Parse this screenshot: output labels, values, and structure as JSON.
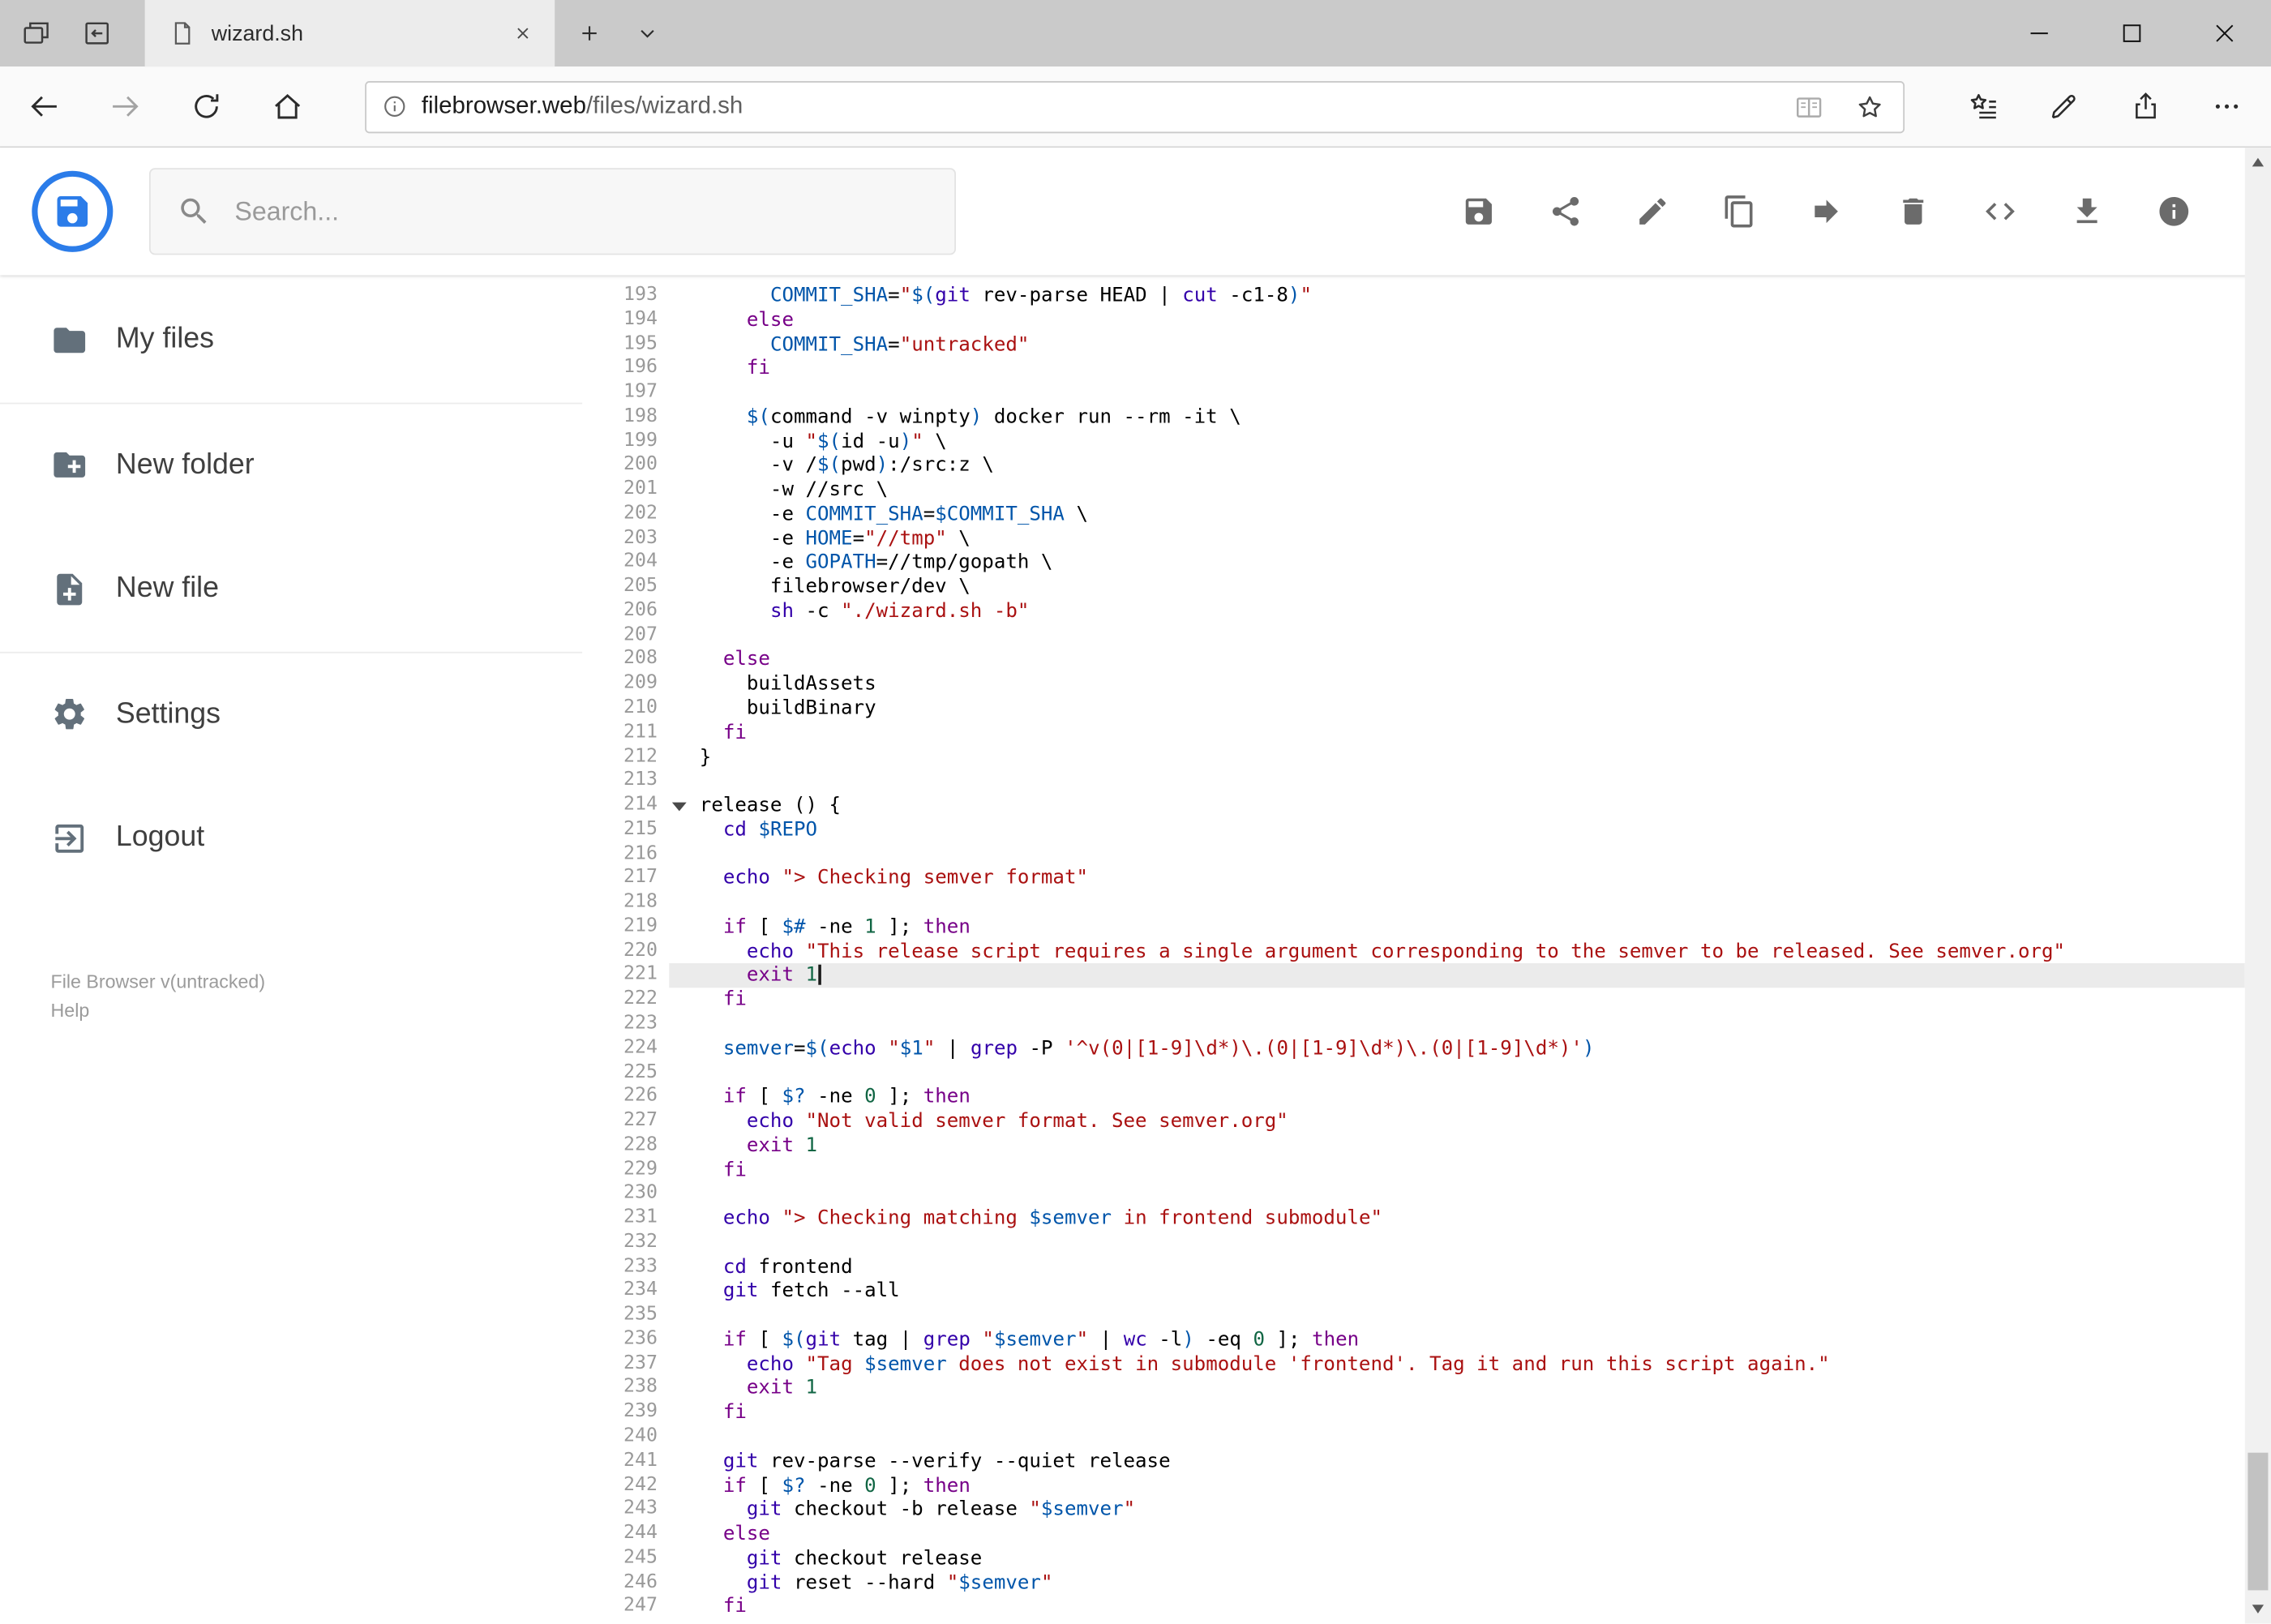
{
  "window": {
    "tab_title": "wizard.sh",
    "tabbar_icons": [
      "tab-preview-icon",
      "set-tabs-aside-icon",
      "page-icon",
      "close-tab-icon",
      "new-tab-icon",
      "tab-list-chevron-icon"
    ],
    "control_icons": [
      "minimize-icon",
      "maximize-icon",
      "close-icon"
    ]
  },
  "browser": {
    "url_domain": "filebrowser.web",
    "url_path": "/files/wizard.sh",
    "nav_icons": [
      "back-icon",
      "forward-icon",
      "refresh-icon",
      "home-icon",
      "site-info-icon",
      "reading-view-icon",
      "favorite-star-icon",
      "hub-icon",
      "web-note-pen-icon",
      "share-icon",
      "more-options-icon"
    ]
  },
  "app_header": {
    "search_placeholder": "Search...",
    "logo_icon": "file-browser-floppy-logo",
    "action_icons": [
      "save-icon",
      "share-icon",
      "edit-icon",
      "copy-icon",
      "move-icon",
      "delete-icon",
      "switch-view-icon",
      "download-icon",
      "info-icon"
    ]
  },
  "sidebar": {
    "items": [
      {
        "label": "My files",
        "icon": "folder-icon"
      },
      {
        "label": "New folder",
        "icon": "new-folder-icon"
      },
      {
        "label": "New file",
        "icon": "new-file-icon"
      },
      {
        "label": "Settings",
        "icon": "settings-gear-icon"
      },
      {
        "label": "Logout",
        "icon": "logout-icon"
      }
    ],
    "credits": "File Browser v(untracked)",
    "help": "Help"
  },
  "colors": {
    "accent_blue": "#2b7ce9",
    "active_line_bg": "#ebebeb",
    "gutter_number": "#999999"
  },
  "scrollbar": {
    "thumb_top_pct": 90,
    "thumb_height_pct": 9.7
  },
  "editor": {
    "language": "shell",
    "active_line": 221,
    "folded_marker_line": 214,
    "token_colors": {
      "pl": "#000000",
      "kw": "#770088",
      "bi": "#3300aa",
      "st": "#aa1111",
      "va": "#0055aa",
      "nu": "#116644"
    },
    "lines": [
      {
        "n": 193,
        "t": [
          [
            "pl",
            "      "
          ],
          [
            "va",
            "COMMIT_SHA"
          ],
          [
            "pl",
            "="
          ],
          [
            "st",
            "\""
          ],
          [
            "va",
            "$("
          ],
          [
            "bi",
            "git"
          ],
          [
            "pl",
            " rev-parse HEAD | "
          ],
          [
            "bi",
            "cut"
          ],
          [
            "pl",
            " -c1-8"
          ],
          [
            "va",
            ")"
          ],
          [
            "st",
            "\""
          ]
        ]
      },
      {
        "n": 194,
        "t": [
          [
            "pl",
            "    "
          ],
          [
            "kw",
            "else"
          ]
        ]
      },
      {
        "n": 195,
        "t": [
          [
            "pl",
            "      "
          ],
          [
            "va",
            "COMMIT_SHA"
          ],
          [
            "pl",
            "="
          ],
          [
            "st",
            "\"untracked\""
          ]
        ]
      },
      {
        "n": 196,
        "t": [
          [
            "pl",
            "    "
          ],
          [
            "kw",
            "fi"
          ]
        ]
      },
      {
        "n": 197,
        "t": []
      },
      {
        "n": 198,
        "t": [
          [
            "pl",
            "    "
          ],
          [
            "va",
            "$("
          ],
          [
            "pl",
            "command -v winpty"
          ],
          [
            "va",
            ")"
          ],
          [
            "pl",
            " docker run --rm -it \\"
          ]
        ]
      },
      {
        "n": 199,
        "t": [
          [
            "pl",
            "      -u "
          ],
          [
            "st",
            "\""
          ],
          [
            "va",
            "$("
          ],
          [
            "pl",
            "id -u"
          ],
          [
            "va",
            ")"
          ],
          [
            "st",
            "\""
          ],
          [
            "pl",
            " \\"
          ]
        ]
      },
      {
        "n": 200,
        "t": [
          [
            "pl",
            "      -v /"
          ],
          [
            "va",
            "$("
          ],
          [
            "pl",
            "pwd"
          ],
          [
            "va",
            ")"
          ],
          [
            "pl",
            ":/src:z \\"
          ]
        ]
      },
      {
        "n": 201,
        "t": [
          [
            "pl",
            "      -w //src \\"
          ]
        ]
      },
      {
        "n": 202,
        "t": [
          [
            "pl",
            "      -e "
          ],
          [
            "va",
            "COMMIT_SHA"
          ],
          [
            "pl",
            "="
          ],
          [
            "va",
            "$COMMIT_SHA"
          ],
          [
            "pl",
            " \\"
          ]
        ]
      },
      {
        "n": 203,
        "t": [
          [
            "pl",
            "      -e "
          ],
          [
            "va",
            "HOME"
          ],
          [
            "pl",
            "="
          ],
          [
            "st",
            "\"//tmp\""
          ],
          [
            "pl",
            " \\"
          ]
        ]
      },
      {
        "n": 204,
        "t": [
          [
            "pl",
            "      -e "
          ],
          [
            "va",
            "GOPATH"
          ],
          [
            "pl",
            "=//tmp/gopath \\"
          ]
        ]
      },
      {
        "n": 205,
        "t": [
          [
            "pl",
            "      filebrowser/dev \\"
          ]
        ]
      },
      {
        "n": 206,
        "t": [
          [
            "pl",
            "      "
          ],
          [
            "bi",
            "sh"
          ],
          [
            "pl",
            " -c "
          ],
          [
            "st",
            "\"./wizard.sh -b\""
          ]
        ]
      },
      {
        "n": 207,
        "t": []
      },
      {
        "n": 208,
        "t": [
          [
            "pl",
            "  "
          ],
          [
            "kw",
            "else"
          ]
        ]
      },
      {
        "n": 209,
        "t": [
          [
            "pl",
            "    buildAssets"
          ]
        ]
      },
      {
        "n": 210,
        "t": [
          [
            "pl",
            "    buildBinary"
          ]
        ]
      },
      {
        "n": 211,
        "t": [
          [
            "pl",
            "  "
          ],
          [
            "kw",
            "fi"
          ]
        ]
      },
      {
        "n": 212,
        "t": [
          [
            "pl",
            "}"
          ]
        ]
      },
      {
        "n": 213,
        "t": []
      },
      {
        "n": 214,
        "t": [
          [
            "pl",
            "release () {"
          ]
        ]
      },
      {
        "n": 215,
        "t": [
          [
            "pl",
            "  "
          ],
          [
            "bi",
            "cd"
          ],
          [
            "pl",
            " "
          ],
          [
            "va",
            "$REPO"
          ]
        ]
      },
      {
        "n": 216,
        "t": []
      },
      {
        "n": 217,
        "t": [
          [
            "pl",
            "  "
          ],
          [
            "bi",
            "echo"
          ],
          [
            "pl",
            " "
          ],
          [
            "st",
            "\"> Checking semver format\""
          ]
        ]
      },
      {
        "n": 218,
        "t": []
      },
      {
        "n": 219,
        "t": [
          [
            "pl",
            "  "
          ],
          [
            "kw",
            "if"
          ],
          [
            "pl",
            " [ "
          ],
          [
            "va",
            "$#"
          ],
          [
            "pl",
            " -ne "
          ],
          [
            "nu",
            "1"
          ],
          [
            "pl",
            " ]; "
          ],
          [
            "kw",
            "then"
          ]
        ]
      },
      {
        "n": 220,
        "t": [
          [
            "pl",
            "    "
          ],
          [
            "bi",
            "echo"
          ],
          [
            "pl",
            " "
          ],
          [
            "st",
            "\"This release script requires a single argument corresponding to the semver to be released. See semver.org\""
          ]
        ]
      },
      {
        "n": 221,
        "t": [
          [
            "pl",
            "    "
          ],
          [
            "kw",
            "exit"
          ],
          [
            "pl",
            " "
          ],
          [
            "nu",
            "1"
          ]
        ]
      },
      {
        "n": 222,
        "t": [
          [
            "pl",
            "  "
          ],
          [
            "kw",
            "fi"
          ]
        ]
      },
      {
        "n": 223,
        "t": []
      },
      {
        "n": 224,
        "t": [
          [
            "pl",
            "  "
          ],
          [
            "va",
            "semver"
          ],
          [
            "pl",
            "="
          ],
          [
            "va",
            "$("
          ],
          [
            "bi",
            "echo"
          ],
          [
            "pl",
            " "
          ],
          [
            "st",
            "\""
          ],
          [
            "va",
            "$1"
          ],
          [
            "st",
            "\""
          ],
          [
            "pl",
            " | "
          ],
          [
            "bi",
            "grep"
          ],
          [
            "pl",
            " -P "
          ],
          [
            "st",
            "'^v(0|[1-9]\\d*)\\.(0|[1-9]\\d*)\\.(0|[1-9]\\d*)'"
          ],
          [
            "va",
            ")"
          ]
        ]
      },
      {
        "n": 225,
        "t": []
      },
      {
        "n": 226,
        "t": [
          [
            "pl",
            "  "
          ],
          [
            "kw",
            "if"
          ],
          [
            "pl",
            " [ "
          ],
          [
            "va",
            "$?"
          ],
          [
            "pl",
            " -ne "
          ],
          [
            "nu",
            "0"
          ],
          [
            "pl",
            " ]; "
          ],
          [
            "kw",
            "then"
          ]
        ]
      },
      {
        "n": 227,
        "t": [
          [
            "pl",
            "    "
          ],
          [
            "bi",
            "echo"
          ],
          [
            "pl",
            " "
          ],
          [
            "st",
            "\"Not valid semver format. See semver.org\""
          ]
        ]
      },
      {
        "n": 228,
        "t": [
          [
            "pl",
            "    "
          ],
          [
            "kw",
            "exit"
          ],
          [
            "pl",
            " "
          ],
          [
            "nu",
            "1"
          ]
        ]
      },
      {
        "n": 229,
        "t": [
          [
            "pl",
            "  "
          ],
          [
            "kw",
            "fi"
          ]
        ]
      },
      {
        "n": 230,
        "t": []
      },
      {
        "n": 231,
        "t": [
          [
            "pl",
            "  "
          ],
          [
            "bi",
            "echo"
          ],
          [
            "pl",
            " "
          ],
          [
            "st",
            "\"> Checking matching "
          ],
          [
            "va",
            "$semver"
          ],
          [
            "st",
            " in frontend submodule\""
          ]
        ]
      },
      {
        "n": 232,
        "t": []
      },
      {
        "n": 233,
        "t": [
          [
            "pl",
            "  "
          ],
          [
            "bi",
            "cd"
          ],
          [
            "pl",
            " frontend"
          ]
        ]
      },
      {
        "n": 234,
        "t": [
          [
            "pl",
            "  "
          ],
          [
            "bi",
            "git"
          ],
          [
            "pl",
            " fetch --all"
          ]
        ]
      },
      {
        "n": 235,
        "t": []
      },
      {
        "n": 236,
        "t": [
          [
            "pl",
            "  "
          ],
          [
            "kw",
            "if"
          ],
          [
            "pl",
            " [ "
          ],
          [
            "va",
            "$("
          ],
          [
            "bi",
            "git"
          ],
          [
            "pl",
            " tag | "
          ],
          [
            "bi",
            "grep"
          ],
          [
            "pl",
            " "
          ],
          [
            "st",
            "\""
          ],
          [
            "va",
            "$semver"
          ],
          [
            "st",
            "\""
          ],
          [
            "pl",
            " | "
          ],
          [
            "bi",
            "wc"
          ],
          [
            "pl",
            " -l"
          ],
          [
            "va",
            ")"
          ],
          [
            "pl",
            " -eq "
          ],
          [
            "nu",
            "0"
          ],
          [
            "pl",
            " ]; "
          ],
          [
            "kw",
            "then"
          ]
        ]
      },
      {
        "n": 237,
        "t": [
          [
            "pl",
            "    "
          ],
          [
            "bi",
            "echo"
          ],
          [
            "pl",
            " "
          ],
          [
            "st",
            "\"Tag "
          ],
          [
            "va",
            "$semver"
          ],
          [
            "st",
            " does not exist in submodule 'frontend'. Tag it and run this script again.\""
          ]
        ]
      },
      {
        "n": 238,
        "t": [
          [
            "pl",
            "    "
          ],
          [
            "kw",
            "exit"
          ],
          [
            "pl",
            " "
          ],
          [
            "nu",
            "1"
          ]
        ]
      },
      {
        "n": 239,
        "t": [
          [
            "pl",
            "  "
          ],
          [
            "kw",
            "fi"
          ]
        ]
      },
      {
        "n": 240,
        "t": []
      },
      {
        "n": 241,
        "t": [
          [
            "pl",
            "  "
          ],
          [
            "bi",
            "git"
          ],
          [
            "pl",
            " rev-parse --verify --quiet release"
          ]
        ]
      },
      {
        "n": 242,
        "t": [
          [
            "pl",
            "  "
          ],
          [
            "kw",
            "if"
          ],
          [
            "pl",
            " [ "
          ],
          [
            "va",
            "$?"
          ],
          [
            "pl",
            " -ne "
          ],
          [
            "nu",
            "0"
          ],
          [
            "pl",
            " ]; "
          ],
          [
            "kw",
            "then"
          ]
        ]
      },
      {
        "n": 243,
        "t": [
          [
            "pl",
            "    "
          ],
          [
            "bi",
            "git"
          ],
          [
            "pl",
            " checkout -b release "
          ],
          [
            "st",
            "\""
          ],
          [
            "va",
            "$semver"
          ],
          [
            "st",
            "\""
          ]
        ]
      },
      {
        "n": 244,
        "t": [
          [
            "pl",
            "  "
          ],
          [
            "kw",
            "else"
          ]
        ]
      },
      {
        "n": 245,
        "t": [
          [
            "pl",
            "    "
          ],
          [
            "bi",
            "git"
          ],
          [
            "pl",
            " checkout release"
          ]
        ]
      },
      {
        "n": 246,
        "t": [
          [
            "pl",
            "    "
          ],
          [
            "bi",
            "git"
          ],
          [
            "pl",
            " reset --hard "
          ],
          [
            "st",
            "\""
          ],
          [
            "va",
            "$semver"
          ],
          [
            "st",
            "\""
          ]
        ]
      },
      {
        "n": 247,
        "t": [
          [
            "pl",
            "  "
          ],
          [
            "kw",
            "fi"
          ]
        ]
      }
    ]
  }
}
